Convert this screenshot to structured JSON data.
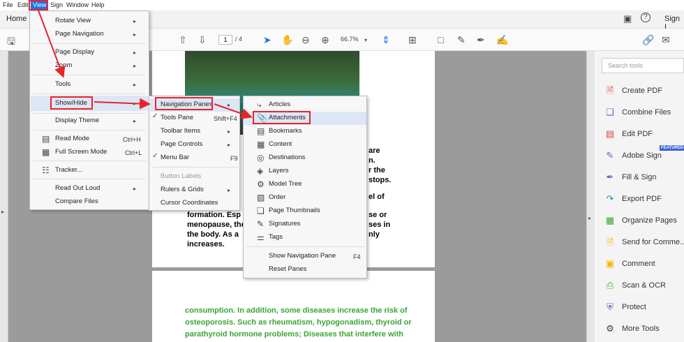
{
  "menubar": {
    "file": "File",
    "edit": "Edit",
    "view": "View",
    "sign": "Sign",
    "window": "Window",
    "help": "Help"
  },
  "tabs": {
    "home": "Home",
    "sign_in": "Sign I"
  },
  "toolbar": {
    "page_current": "1",
    "page_total": "/ 4",
    "zoom": "66.7%"
  },
  "document": {
    "para1_lines": [
      "are",
      "n.",
      "r the",
      "stops.",
      "el of"
    ],
    "para2_lines": [
      "formation. Esp",
      "menopause, the",
      "the body. As a",
      "increases."
    ],
    "para2_right": [
      "se or",
      "ses in",
      "nly"
    ],
    "green_lines": [
      "consumption. In addition, some diseases increase the risk of",
      "osteoporosis. Such as rheumatism, hypogonadism, thyroid or",
      "parathyroid hormone problems; Diseases that interfere with"
    ]
  },
  "view_menu": {
    "items": [
      "Rotate View",
      "Page Navigation",
      "Page Display",
      "Zoom",
      "Tools",
      "Show/Hide",
      "Display Theme",
      "Read Mode",
      "Full Screen Mode",
      "Tracker...",
      "Read Out Loud",
      "Compare Files"
    ],
    "shortcuts": {
      "read_mode": "Ctrl+H",
      "full_screen": "Ctrl+L"
    }
  },
  "showhide_menu": {
    "items": [
      "Navigation Panes",
      "Tools Pane",
      "Toolbar Items",
      "Page Controls",
      "Menu Bar",
      "Button Labels",
      "Rulers & Grids",
      "Cursor Coordinates"
    ],
    "shortcuts": {
      "tools_pane": "Shift+F4",
      "menu_bar": "F9"
    }
  },
  "navpanes_menu": {
    "items": [
      "Articles",
      "Attachments",
      "Bookmarks",
      "Content",
      "Destinations",
      "Layers",
      "Model Tree",
      "Order",
      "Page Thumbnails",
      "Signatures",
      "Tags",
      "Show Navigation Pane",
      "Reset Panes"
    ],
    "shortcuts": {
      "show_nav": "F4"
    }
  },
  "right_panel": {
    "search_placeholder": "Search tools",
    "featured": "FEATURED",
    "tools": [
      {
        "label": "Create PDF",
        "color": "#e0443b"
      },
      {
        "label": "Combine Files",
        "color": "#5b5bd6"
      },
      {
        "label": "Edit PDF",
        "color": "#e0443b"
      },
      {
        "label": "Adobe Sign",
        "color": "#8a4ad0"
      },
      {
        "label": "Fill & Sign",
        "color": "#8a4ad0"
      },
      {
        "label": "Export PDF",
        "color": "#1e88c7"
      },
      {
        "label": "Organize Pages",
        "color": "#3aa535"
      },
      {
        "label": "Send for Comme...",
        "color": "#f2b600"
      },
      {
        "label": "Comment",
        "color": "#f2b600"
      },
      {
        "label": "Scan & OCR",
        "color": "#3aa535"
      },
      {
        "label": "Protect",
        "color": "#5b5bd6"
      },
      {
        "label": "More Tools",
        "color": "#444444"
      }
    ]
  },
  "colors": {
    "highlight_red": "#e8242b",
    "accent_blue": "#1a73e8"
  }
}
